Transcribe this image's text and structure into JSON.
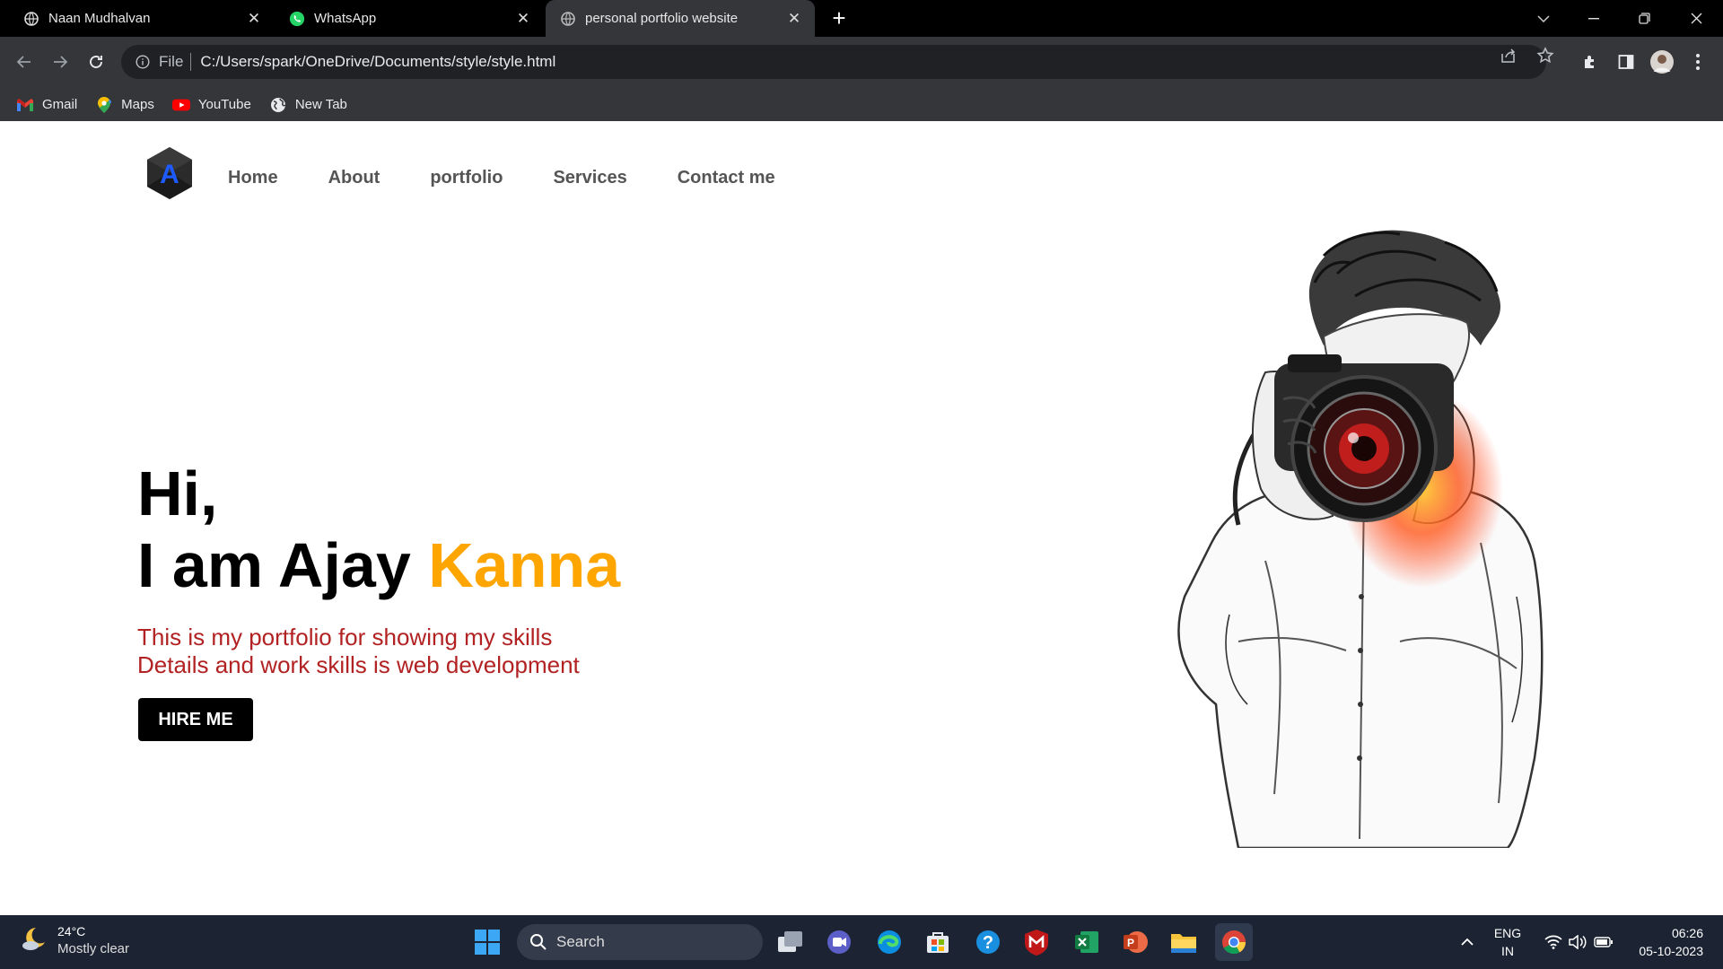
{
  "browser": {
    "tabs": [
      {
        "title": "Naan Mudhalvan",
        "icon": "globe-icon"
      },
      {
        "title": "WhatsApp",
        "icon": "whatsapp-icon"
      },
      {
        "title": "personal portfolio website",
        "icon": "globe-icon",
        "active": true
      }
    ],
    "address": {
      "scheme_label": "File",
      "url": "C:/Users/spark/OneDrive/Documents/style/style.html"
    },
    "bookmarks": [
      {
        "label": "Gmail",
        "icon": "gmail-icon"
      },
      {
        "label": "Maps",
        "icon": "maps-icon"
      },
      {
        "label": "YouTube",
        "icon": "youtube-icon"
      },
      {
        "label": "New Tab",
        "icon": "globe-icon"
      }
    ]
  },
  "site": {
    "logo_letter": "A",
    "nav": [
      "Home",
      "About",
      "portfolio",
      "Services",
      "Contact me"
    ],
    "hero": {
      "greeting": "Hi,",
      "intro": "I am Ajay ",
      "highlight": "Kanna",
      "description_line1": "This is my portfolio for showing my skills",
      "description_line2": "Details and work skills is web development",
      "button": "HIRE ME"
    },
    "colors": {
      "accent": "#ffa500",
      "description": "#b22222",
      "nav": "#555555"
    }
  },
  "taskbar": {
    "weather_temp": "24°C",
    "weather_condition": "Mostly clear",
    "search_label": "Search",
    "language_line1": "ENG",
    "language_line2": "IN",
    "time": "06:26",
    "date": "05-10-2023"
  }
}
